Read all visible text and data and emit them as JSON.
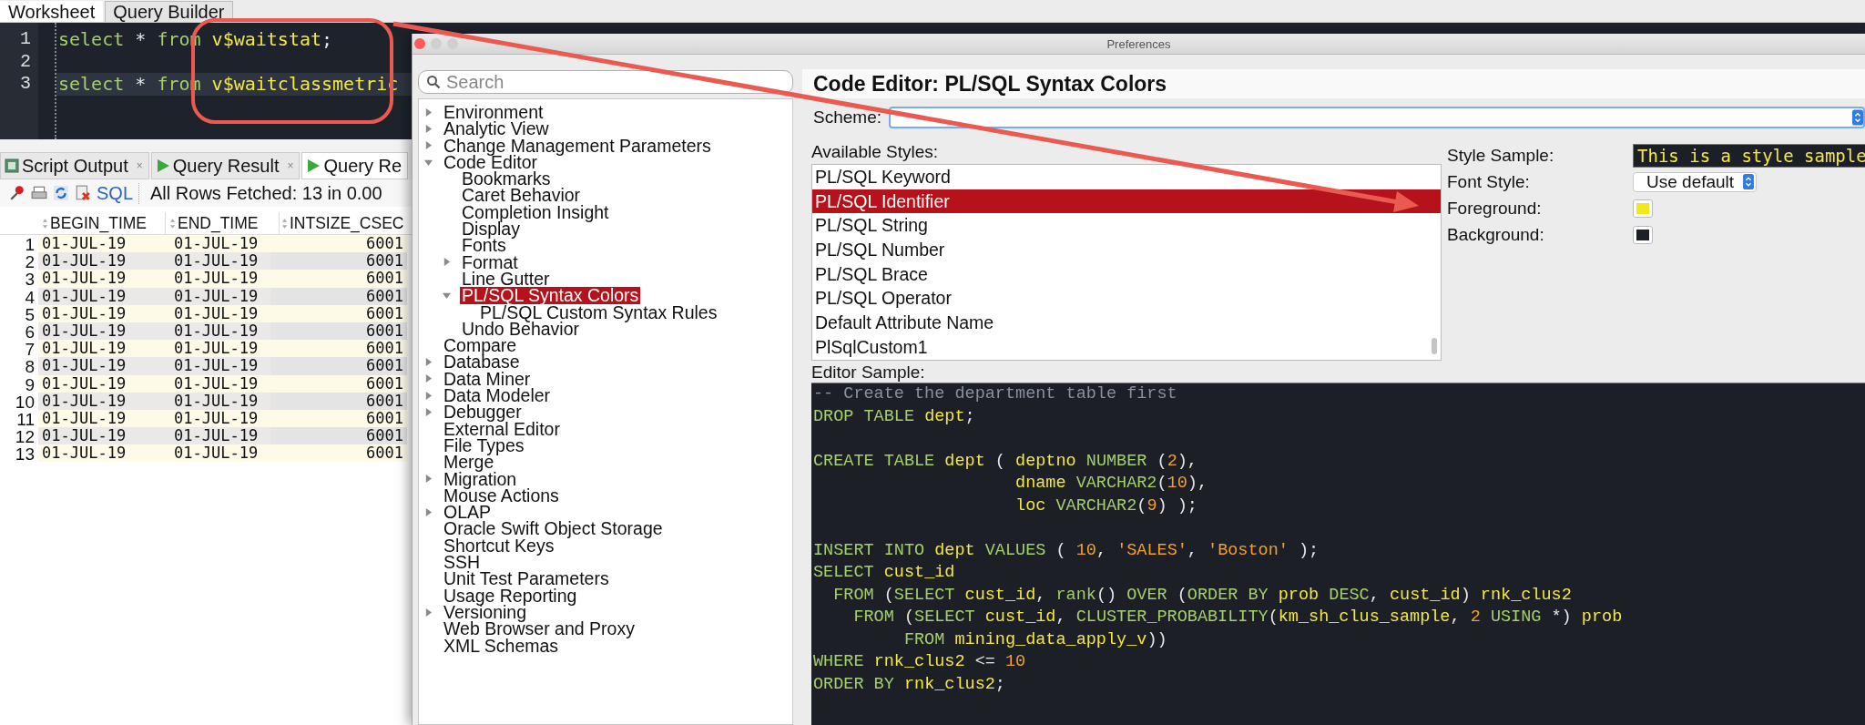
{
  "ide": {
    "editor_tabs": [
      {
        "label": "Worksheet",
        "selected": true
      },
      {
        "label": "Query Builder",
        "selected": false
      }
    ],
    "editor_lines": [
      {
        "number": "1",
        "current": false,
        "tokens": [
          {
            "text": "select",
            "kind": "keyword"
          },
          {
            "text": " * ",
            "kind": "plain"
          },
          {
            "text": "from ",
            "kind": "keyword"
          },
          {
            "text": "v$waitstat",
            "kind": "identifier"
          },
          {
            "text": ";",
            "kind": "plain"
          }
        ]
      },
      {
        "number": "2",
        "current": false
      },
      {
        "number": "3",
        "current": true,
        "tokens": [
          {
            "text": "select",
            "kind": "keyword"
          },
          {
            "text": " * ",
            "kind": "plain"
          },
          {
            "text": "from ",
            "kind": "keyword"
          },
          {
            "text": "v$waitclassmetric",
            "kind": "identifier"
          }
        ]
      }
    ],
    "result_tabs": [
      {
        "label": "Script Output",
        "kind": "script",
        "close": "×",
        "selected": false
      },
      {
        "label": "Query Result",
        "kind": "query",
        "close": "×",
        "selected": false
      },
      {
        "label": "Query Re",
        "kind": "query",
        "selected": true
      }
    ],
    "toolbar": {
      "sql": "SQL",
      "status": "All Rows Fetched: 13 in 0.00"
    },
    "results": {
      "columns": [
        "BEGIN_TIME",
        "END_TIME",
        "INTSIZE_CSEC"
      ],
      "rows": [
        {
          "number": "1",
          "cells": [
            "01-JUL-19",
            "01-JUL-19",
            "6001"
          ]
        },
        {
          "number": "2",
          "cells": [
            "01-JUL-19",
            "01-JUL-19",
            "6001"
          ]
        },
        {
          "number": "3",
          "cells": [
            "01-JUL-19",
            "01-JUL-19",
            "6001"
          ]
        },
        {
          "number": "4",
          "cells": [
            "01-JUL-19",
            "01-JUL-19",
            "6001"
          ]
        },
        {
          "number": "5",
          "cells": [
            "01-JUL-19",
            "01-JUL-19",
            "6001"
          ]
        },
        {
          "number": "6",
          "cells": [
            "01-JUL-19",
            "01-JUL-19",
            "6001"
          ]
        },
        {
          "number": "7",
          "cells": [
            "01-JUL-19",
            "01-JUL-19",
            "6001"
          ]
        },
        {
          "number": "8",
          "cells": [
            "01-JUL-19",
            "01-JUL-19",
            "6001"
          ]
        },
        {
          "number": "9",
          "cells": [
            "01-JUL-19",
            "01-JUL-19",
            "6001"
          ]
        },
        {
          "number": "10",
          "cells": [
            "01-JUL-19",
            "01-JUL-19",
            "6001"
          ]
        },
        {
          "number": "11",
          "cells": [
            "01-JUL-19",
            "01-JUL-19",
            "6001"
          ]
        },
        {
          "number": "12",
          "cells": [
            "01-JUL-19",
            "01-JUL-19",
            "6001"
          ]
        },
        {
          "number": "13",
          "cells": [
            "01-JUL-19",
            "01-JUL-19",
            "6001"
          ]
        }
      ]
    }
  },
  "dialog": {
    "title": "Preferences",
    "search": {
      "placeholder": "Search"
    },
    "tree": {
      "items": [
        {
          "label": "Environment",
          "kind": "folder",
          "expanded": false,
          "selected": false
        },
        {
          "label": "Analytic View",
          "kind": "folder",
          "expanded": false,
          "selected": false
        },
        {
          "label": "Change Management Parameters",
          "kind": "folder",
          "expanded": false,
          "selected": false
        },
        {
          "label": "Code Editor",
          "kind": "folder",
          "expanded": true,
          "selected": false,
          "children": [
            {
              "label": "Bookmarks",
              "kind": "leaf",
              "selected": false
            },
            {
              "label": "Caret Behavior",
              "kind": "leaf",
              "selected": false
            },
            {
              "label": "Completion Insight",
              "kind": "leaf",
              "selected": false
            },
            {
              "label": "Display",
              "kind": "leaf",
              "selected": false
            },
            {
              "label": "Fonts",
              "kind": "leaf",
              "selected": false
            },
            {
              "label": "Format",
              "kind": "folder",
              "expanded": false,
              "selected": false
            },
            {
              "label": "Line Gutter",
              "kind": "leaf",
              "selected": false
            },
            {
              "label": "PL/SQL Syntax Colors",
              "kind": "folder",
              "expanded": true,
              "selected": true,
              "children": [
                {
                  "label": "PL/SQL Custom Syntax Rules",
                  "kind": "leaf",
                  "selected": false
                }
              ]
            },
            {
              "label": "Undo Behavior",
              "kind": "leaf",
              "selected": false
            }
          ]
        },
        {
          "label": "Compare",
          "kind": "leaf",
          "selected": false
        },
        {
          "label": "Database",
          "kind": "folder",
          "expanded": false,
          "selected": false
        },
        {
          "label": "Data Miner",
          "kind": "folder",
          "expanded": false,
          "selected": false
        },
        {
          "label": "Data Modeler",
          "kind": "folder",
          "expanded": false,
          "selected": false
        },
        {
          "label": "Debugger",
          "kind": "folder",
          "expanded": false,
          "selected": false
        },
        {
          "label": "External Editor",
          "kind": "leaf",
          "selected": false
        },
        {
          "label": "File Types",
          "kind": "leaf",
          "selected": false
        },
        {
          "label": "Merge",
          "kind": "leaf",
          "selected": false
        },
        {
          "label": "Migration",
          "kind": "folder",
          "expanded": false,
          "selected": false
        },
        {
          "label": "Mouse Actions",
          "kind": "leaf",
          "selected": false
        },
        {
          "label": "OLAP",
          "kind": "folder",
          "expanded": false,
          "selected": false
        },
        {
          "label": "Oracle Swift Object Storage",
          "kind": "leaf",
          "selected": false
        },
        {
          "label": "Shortcut Keys",
          "kind": "leaf",
          "selected": false
        },
        {
          "label": "SSH",
          "kind": "leaf",
          "selected": false
        },
        {
          "label": "Unit Test Parameters",
          "kind": "leaf",
          "selected": false
        },
        {
          "label": "Usage Reporting",
          "kind": "leaf",
          "selected": false
        },
        {
          "label": "Versioning",
          "kind": "folder",
          "expanded": false,
          "selected": false
        },
        {
          "label": "Web Browser and Proxy",
          "kind": "leaf",
          "selected": false
        },
        {
          "label": "XML Schemas",
          "kind": "leaf",
          "selected": false
        }
      ]
    },
    "heading": "Code Editor: PL/SQL Syntax Colors",
    "scheme": {
      "label": "Scheme:"
    },
    "available_styles": {
      "label": "Available Styles:",
      "items": [
        {
          "label": "PL/SQL Keyword",
          "selected": false
        },
        {
          "label": "PL/SQL Identifier",
          "selected": true
        },
        {
          "label": "PL/SQL String",
          "selected": false
        },
        {
          "label": "PL/SQL Number",
          "selected": false
        },
        {
          "label": "PL/SQL Brace",
          "selected": false
        },
        {
          "label": "PL/SQL Operator",
          "selected": false
        },
        {
          "label": "Default Attribute Name",
          "selected": false
        },
        {
          "label": "PlSqlCustom1",
          "selected": false
        }
      ]
    },
    "style_sample": {
      "label": "Style Sample:",
      "text": "This is a style sample"
    },
    "font_style": {
      "label": "Font Style:",
      "value": "Use default"
    },
    "colors": [
      {
        "label": "Foreground:",
        "color": "#f2e81e"
      },
      {
        "label": "Background:",
        "color": "#1c1f26"
      }
    ],
    "editor_sample": {
      "label": "Editor Sample:",
      "lines": [
        {
          "kind": "code",
          "tokens": [
            {
              "text": "-- Create the department table first",
              "kind": "comment"
            }
          ]
        },
        {
          "kind": "code",
          "tokens": [
            {
              "text": "DROP TABLE ",
              "kind": "keyword"
            },
            {
              "text": "dept",
              "kind": "identifier"
            },
            {
              "text": ";",
              "kind": "plain"
            }
          ]
        },
        {
          "kind": "blank"
        },
        {
          "kind": "code",
          "tokens": [
            {
              "text": "CREATE TABLE ",
              "kind": "keyword"
            },
            {
              "text": "dept",
              "kind": "identifier"
            },
            {
              "text": " ( ",
              "kind": "plain"
            },
            {
              "text": "deptno",
              "kind": "identifier"
            },
            {
              "text": " NUMBER ",
              "kind": "keyword"
            },
            {
              "text": "(",
              "kind": "plain"
            },
            {
              "text": "2",
              "kind": "number"
            },
            {
              "text": "),",
              "kind": "plain"
            }
          ]
        },
        {
          "kind": "continued",
          "tokens": [
            {
              "text": "dname",
              "kind": "identifier"
            },
            {
              "text": " VARCHAR2",
              "kind": "keyword"
            },
            {
              "text": "(",
              "kind": "plain"
            },
            {
              "text": "10",
              "kind": "number"
            },
            {
              "text": "),",
              "kind": "plain"
            }
          ]
        },
        {
          "kind": "continued",
          "tokens": [
            {
              "text": "loc",
              "kind": "identifier"
            },
            {
              "text": " VARCHAR2",
              "kind": "keyword"
            },
            {
              "text": "(",
              "kind": "plain"
            },
            {
              "text": "9",
              "kind": "number"
            },
            {
              "text": ") );",
              "kind": "plain"
            }
          ]
        },
        {
          "kind": "blank"
        },
        {
          "kind": "code",
          "tokens": [
            {
              "text": "INSERT INTO ",
              "kind": "keyword"
            },
            {
              "text": "dept",
              "kind": "identifier"
            },
            {
              "text": " VALUES",
              "kind": "keyword"
            },
            {
              "text": " ( ",
              "kind": "plain"
            },
            {
              "text": "10",
              "kind": "number"
            },
            {
              "text": ", ",
              "kind": "plain"
            },
            {
              "text": "'SALES'",
              "kind": "string"
            },
            {
              "text": ", ",
              "kind": "plain"
            },
            {
              "text": "'Boston'",
              "kind": "string"
            },
            {
              "text": " );",
              "kind": "plain"
            }
          ]
        },
        {
          "kind": "code",
          "tokens": [
            {
              "text": "SELECT ",
              "kind": "keyword"
            },
            {
              "text": "cust_id",
              "kind": "identifier"
            }
          ]
        },
        {
          "kind": "code",
          "tokens": [
            {
              "text": "  FROM ",
              "kind": "keyword"
            },
            {
              "text": "(",
              "kind": "plain"
            },
            {
              "text": "SELECT ",
              "kind": "keyword"
            },
            {
              "text": "cust_id",
              "kind": "identifier"
            },
            {
              "text": ", ",
              "kind": "plain"
            },
            {
              "text": "rank",
              "kind": "keyword"
            },
            {
              "text": "() ",
              "kind": "plain"
            },
            {
              "text": "OVER ",
              "kind": "keyword"
            },
            {
              "text": "(",
              "kind": "plain"
            },
            {
              "text": "ORDER BY ",
              "kind": "keyword"
            },
            {
              "text": "prob",
              "kind": "identifier"
            },
            {
              "text": " DESC",
              "kind": "keyword"
            },
            {
              "text": ", ",
              "kind": "plain"
            },
            {
              "text": "cust_id",
              "kind": "identifier"
            },
            {
              "text": ") ",
              "kind": "plain"
            },
            {
              "text": "rnk_clus2",
              "kind": "identifier"
            }
          ]
        },
        {
          "kind": "code",
          "tokens": [
            {
              "text": "    FROM ",
              "kind": "keyword"
            },
            {
              "text": "(",
              "kind": "plain"
            },
            {
              "text": "SELECT ",
              "kind": "keyword"
            },
            {
              "text": "cust_id",
              "kind": "identifier"
            },
            {
              "text": ", ",
              "kind": "plain"
            },
            {
              "text": "CLUSTER_PROBABILITY",
              "kind": "keyword"
            },
            {
              "text": "(",
              "kind": "plain"
            },
            {
              "text": "km_sh_clus_sample",
              "kind": "identifier"
            },
            {
              "text": ", ",
              "kind": "plain"
            },
            {
              "text": "2",
              "kind": "number"
            },
            {
              "text": " USING ",
              "kind": "keyword"
            },
            {
              "text": "*) ",
              "kind": "plain"
            },
            {
              "text": "prob",
              "kind": "identifier"
            }
          ]
        },
        {
          "kind": "code",
          "tokens": [
            {
              "text": "         FROM ",
              "kind": "keyword"
            },
            {
              "text": "mining_data_apply_v",
              "kind": "identifier"
            },
            {
              "text": "))",
              "kind": "plain"
            }
          ]
        },
        {
          "kind": "code",
          "tokens": [
            {
              "text": "WHERE ",
              "kind": "keyword"
            },
            {
              "text": "rnk_clus2",
              "kind": "identifier"
            },
            {
              "text": " <= ",
              "kind": "plain"
            },
            {
              "text": "10",
              "kind": "number"
            }
          ]
        },
        {
          "kind": "code",
          "tokens": [
            {
              "text": "ORDER BY ",
              "kind": "keyword"
            },
            {
              "text": "rnk_clus2",
              "kind": "identifier"
            },
            {
              "text": ";",
              "kind": "plain"
            }
          ]
        }
      ]
    }
  }
}
